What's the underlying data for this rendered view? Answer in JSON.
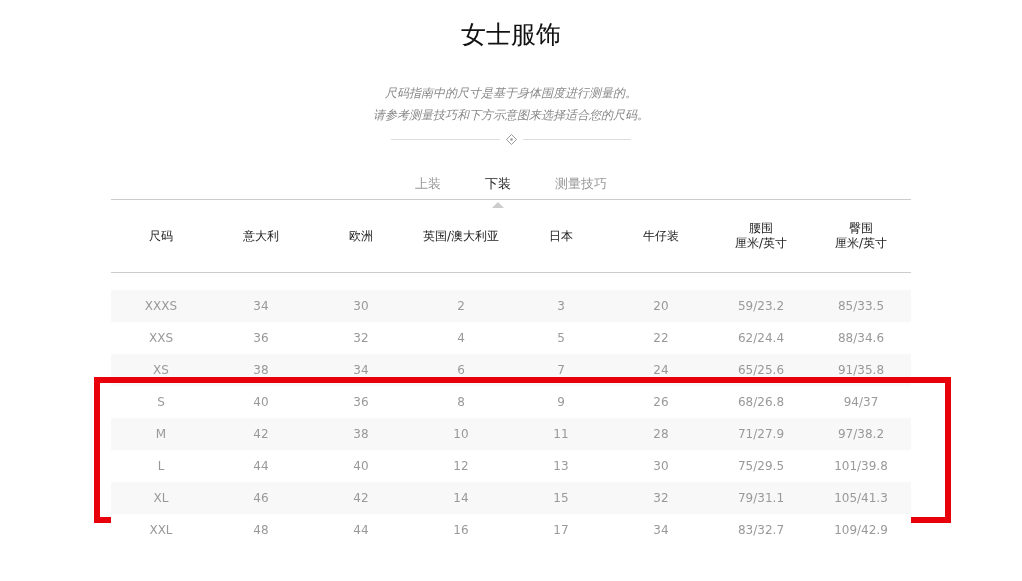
{
  "title": "女士服饰",
  "intro": [
    "尺码指南中的尺寸是基于身体围度进行测量的。",
    "请参考测量技巧和下方示意图来选择适合您的尺码。"
  ],
  "tabs": [
    {
      "label": "上装",
      "selected": false
    },
    {
      "label": "下装",
      "selected": true
    },
    {
      "label": "测量技巧",
      "selected": false
    }
  ],
  "table": {
    "columns": [
      {
        "label": "尺码"
      },
      {
        "label": "意大利"
      },
      {
        "label": "欧洲"
      },
      {
        "label": "英国/澳大利亚"
      },
      {
        "label": "日本"
      },
      {
        "label": "牛仔装"
      },
      {
        "label": "腰围",
        "unit": "厘米/英寸"
      },
      {
        "label": "臀围",
        "unit": "厘米/英寸"
      }
    ],
    "rows": [
      {
        "cells": [
          "XXXS",
          "34",
          "30",
          "2",
          "3",
          "20",
          "59/23.2",
          "85/33.5"
        ],
        "highlighted": false
      },
      {
        "cells": [
          "XXS",
          "36",
          "32",
          "4",
          "5",
          "22",
          "62/24.4",
          "88/34.6"
        ],
        "highlighted": false
      },
      {
        "cells": [
          "XS",
          "38",
          "34",
          "6",
          "7",
          "24",
          "65/25.6",
          "91/35.8"
        ],
        "highlighted": false
      },
      {
        "cells": [
          "S",
          "40",
          "36",
          "8",
          "9",
          "26",
          "68/26.8",
          "94/37"
        ],
        "highlighted": true
      },
      {
        "cells": [
          "M",
          "42",
          "38",
          "10",
          "11",
          "28",
          "71/27.9",
          "97/38.2"
        ],
        "highlighted": true
      },
      {
        "cells": [
          "L",
          "44",
          "40",
          "12",
          "13",
          "30",
          "75/29.5",
          "101/39.8"
        ],
        "highlighted": true
      },
      {
        "cells": [
          "XL",
          "46",
          "42",
          "14",
          "15",
          "32",
          "79/31.1",
          "105/41.3"
        ],
        "highlighted": true
      },
      {
        "cells": [
          "XXL",
          "48",
          "44",
          "16",
          "17",
          "34",
          "83/32.7",
          "109/42.9"
        ],
        "highlighted": false
      }
    ]
  }
}
